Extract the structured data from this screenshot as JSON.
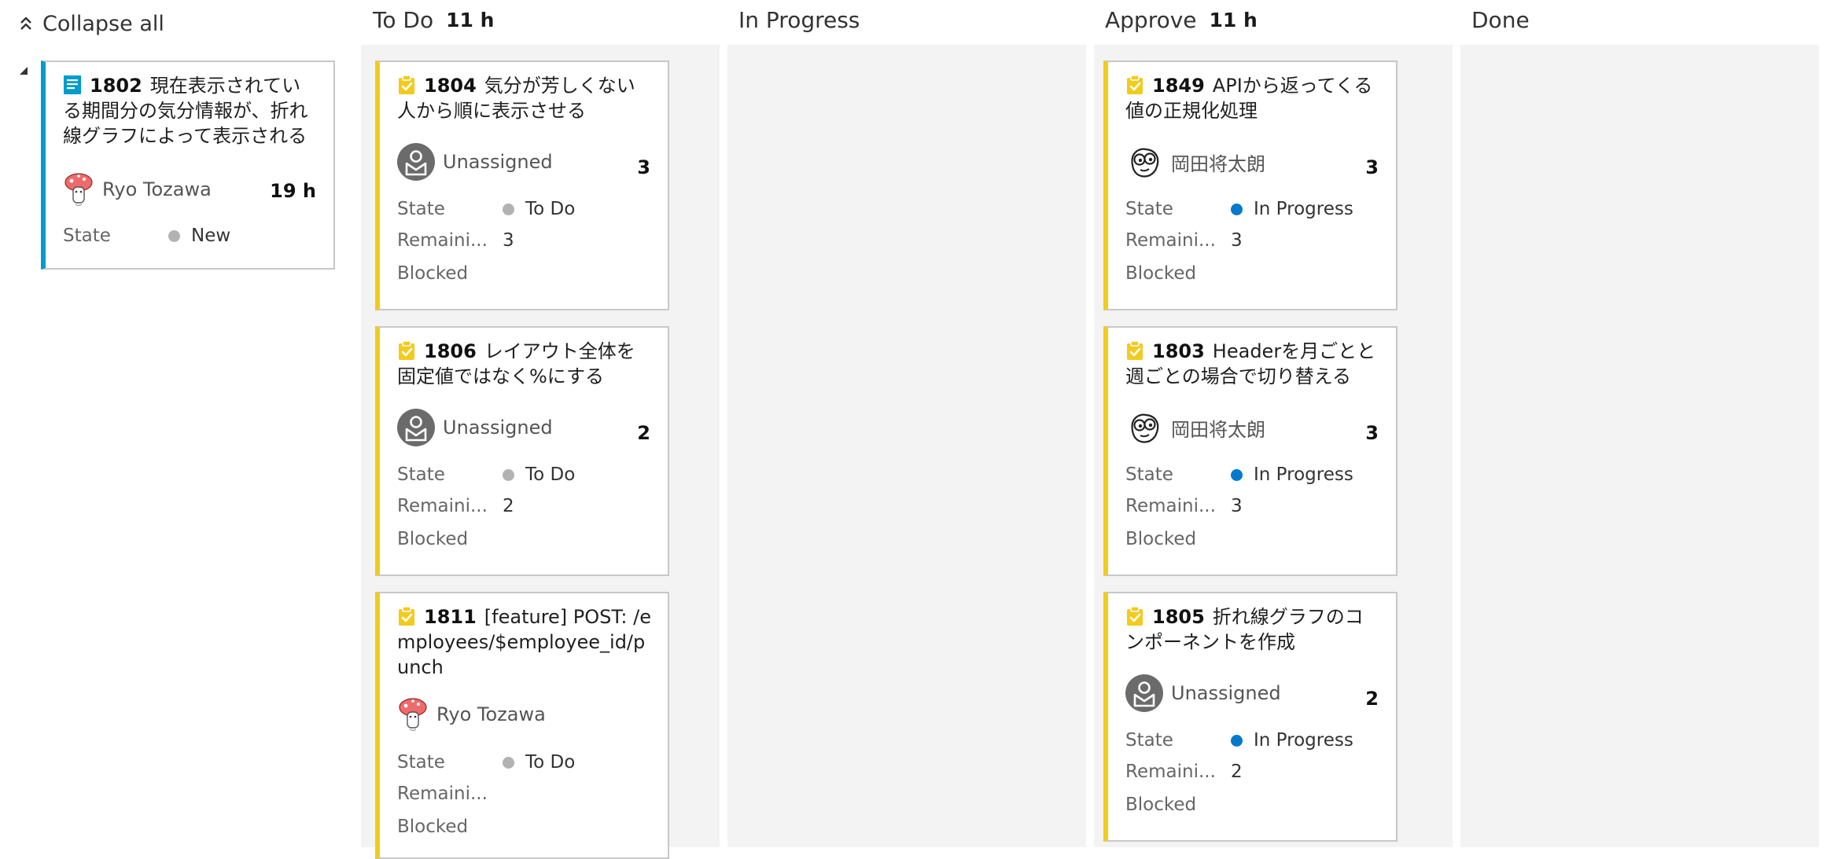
{
  "toolbar": {
    "collapse_all": "Collapse all"
  },
  "colors": {
    "task_accent": "#f2cb1d",
    "story_accent": "#009ccc",
    "state_new": "#b2b2b2",
    "state_todo": "#b2b2b2",
    "state_in_progress": "#007acc",
    "column_background": "#f3f3f3"
  },
  "labels": {
    "state": "State",
    "remaining": "Remaini...",
    "blocked": "Blocked"
  },
  "parent": {
    "id": "1802",
    "title": "現在表示されている期間分の気分情報が、折れ線グラフによって表示される",
    "type_icon": "user-story-icon",
    "assignee": "Ryo Tozawa",
    "effort": "19 h",
    "state": "New"
  },
  "columns": [
    {
      "name": "To Do",
      "count": "11 h"
    },
    {
      "name": "In Progress",
      "count": ""
    },
    {
      "name": "Approve",
      "count": "11 h"
    },
    {
      "name": "Done",
      "count": ""
    }
  ],
  "todo_cards": [
    {
      "id": "1804",
      "title": "気分が芳しくない人から順に表示させる",
      "assignee": "Unassigned",
      "effort": "3",
      "state": "To Do",
      "remaining": "3"
    },
    {
      "id": "1806",
      "title": "レイアウト全体を固定値ではなく%にする",
      "assignee": "Unassigned",
      "effort": "2",
      "state": "To Do",
      "remaining": "2"
    },
    {
      "id": "1811",
      "title": "[feature] POST: /employees/$employee_id/punch",
      "assignee": "Ryo Tozawa",
      "effort": "",
      "state": "To Do",
      "remaining": ""
    }
  ],
  "approve_cards": [
    {
      "id": "1849",
      "title": "APIから返ってくる値の正規化処理",
      "assignee": "岡田将太朗",
      "effort": "3",
      "state": "In Progress",
      "remaining": "3"
    },
    {
      "id": "1803",
      "title": "Headerを月ごとと週ごとの場合で切り替える",
      "assignee": "岡田将太朗",
      "effort": "3",
      "state": "In Progress",
      "remaining": "3"
    },
    {
      "id": "1805",
      "title": "折れ線グラフのコンポーネントを作成",
      "assignee": "Unassigned",
      "effort": "2",
      "state": "In Progress",
      "remaining": "2"
    }
  ]
}
